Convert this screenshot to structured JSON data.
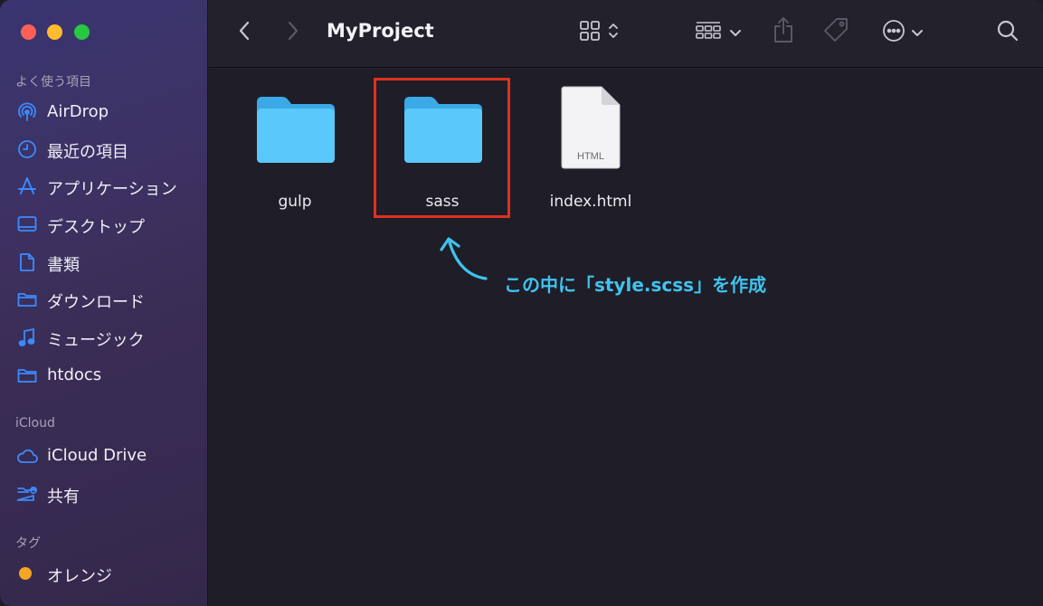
{
  "window": {
    "title": "MyProject"
  },
  "sidebar": {
    "favorites_title": "よく使う項目",
    "favorites": [
      {
        "label": "AirDrop",
        "icon": "airdrop-icon"
      },
      {
        "label": "最近の項目",
        "icon": "clock-icon"
      },
      {
        "label": "アプリケーション",
        "icon": "applications-icon"
      },
      {
        "label": "デスクトップ",
        "icon": "desktop-icon"
      },
      {
        "label": "書類",
        "icon": "document-icon"
      },
      {
        "label": "ダウンロード",
        "icon": "folder-icon"
      },
      {
        "label": "ミュージック",
        "icon": "music-note-icon"
      },
      {
        "label": "htdocs",
        "icon": "folder-icon"
      }
    ],
    "icloud_title": "iCloud",
    "icloud": [
      {
        "label": "iCloud Drive",
        "icon": "cloud-icon"
      },
      {
        "label": "共有",
        "icon": "shared-folder-icon"
      }
    ],
    "tags_title": "タグ",
    "tags": [
      {
        "label": "オレンジ",
        "color": "#f5a623"
      }
    ]
  },
  "files": [
    {
      "name": "gulp",
      "kind": "folder"
    },
    {
      "name": "sass",
      "kind": "folder"
    },
    {
      "name": "index.html",
      "kind": "html",
      "badge": "HTML"
    }
  ],
  "annotation": {
    "text": "この中に「style.scss」を作成",
    "color": "#3fc3ee"
  },
  "colors": {
    "accent": "#3b8bff",
    "folder": "#5ac8fa",
    "highlight": "#e0311f"
  }
}
